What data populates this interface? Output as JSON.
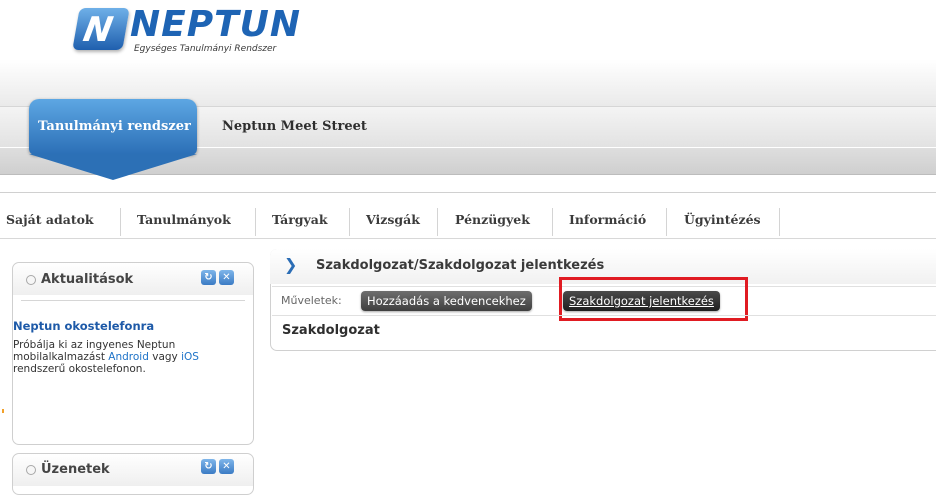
{
  "logo": {
    "letter": "N",
    "title": "NEPTUN",
    "subtitle": "Egységes Tanulmányi Rendszer"
  },
  "top_tabs": [
    {
      "label": "Tanulmányi rendszer",
      "active": true
    },
    {
      "label": "Neptun Meet Street",
      "active": false
    }
  ],
  "main_menu": [
    {
      "label": "Saját adatok"
    },
    {
      "label": "Tanulmányok"
    },
    {
      "label": "Tárgyak"
    },
    {
      "label": "Vizsgák"
    },
    {
      "label": "Pénzügyek"
    },
    {
      "label": "Információ"
    },
    {
      "label": "Ügyintézés"
    }
  ],
  "sidebar": {
    "news_box": {
      "title": "Aktualitások",
      "item_title": "Neptun okostelefonra",
      "body_before": "Próbálja ki az ingyenes Neptun mobilalkalmazást ",
      "android": "Android",
      "body_middle": " vagy ",
      "ios": "iOS",
      "body_after": " rendszerű okostelefonon."
    },
    "messages_box": {
      "title": "Üzenetek"
    }
  },
  "panel": {
    "title": "Szakdolgozat/Szakdolgozat jelentkezés",
    "ops_label": "Műveletek:",
    "ops": [
      {
        "label": "Hozzáadás a kedvencekhez"
      },
      {
        "label": "Szakdolgozat jelentkezés",
        "highlighted": true
      }
    ],
    "content_title": "Szakdolgozat"
  },
  "icons": {
    "refresh": "refresh-icon",
    "close": "close-icon",
    "arrow": "chevron-right-icon",
    "dot": "bullet-icon"
  },
  "colors": {
    "accent": "#2b6fb6",
    "highlight": "#e01b22",
    "link": "#1e5aa8"
  }
}
